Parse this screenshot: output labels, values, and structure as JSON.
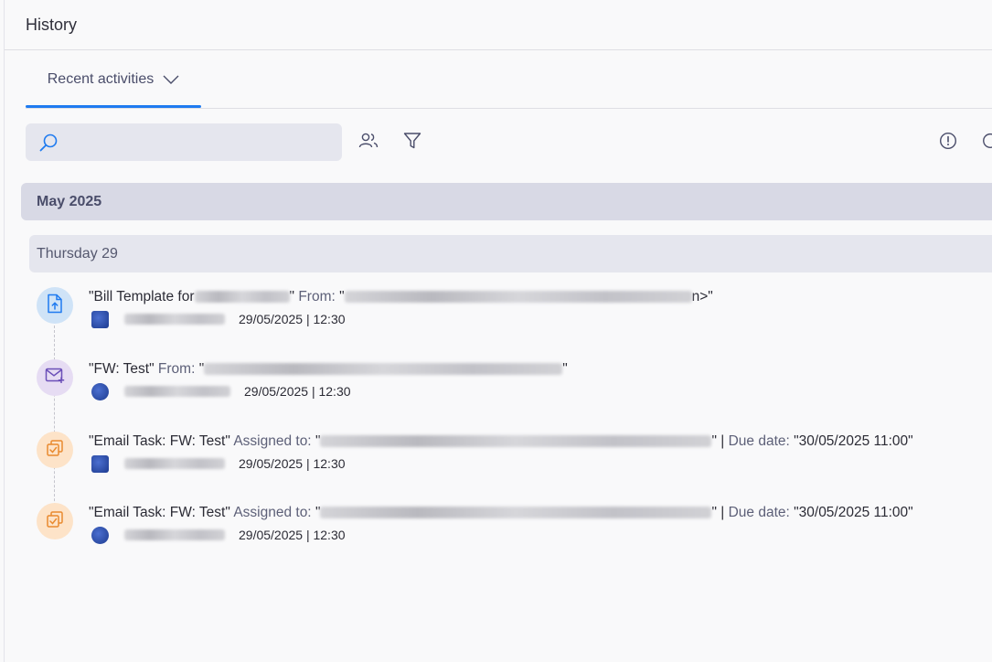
{
  "panel": {
    "title": "History"
  },
  "tabs": {
    "recent_label": "Recent activities"
  },
  "search": {
    "placeholder": ""
  },
  "groups": {
    "month": "May 2025",
    "day": "Thursday 29"
  },
  "icons": {
    "search": "search-icon",
    "users": "users-icon",
    "filter": "filter-icon",
    "info": "info-icon",
    "refresh": "refresh-icon",
    "doc_upload": "document-upload-icon",
    "mail": "mail-icon",
    "task": "task-icon"
  },
  "colors": {
    "accent": "#1f7bf0",
    "doc_bg": "#cfe3f7",
    "mail_bg": "#e6dcf3",
    "task_bg": "#fde3c8",
    "task_fg": "#e98a2f"
  },
  "activities": [
    {
      "title_prefix": "\"Bill Template for",
      "title_suffix": "\"",
      "from_label": "From:",
      "from_open": "\"",
      "from_close": "n>\"",
      "timestamp": "29/05/2025 | 12:30"
    },
    {
      "title": "\"FW: Test\"",
      "from_label": "From:",
      "from_open": "\"",
      "from_close": "\"",
      "timestamp": "29/05/2025 | 12:30"
    },
    {
      "title": "\"Email Task: FW: Test\"",
      "assigned_label": "Assigned to:",
      "assigned_open": "\"",
      "assigned_close": "\" |",
      "due_label": "Due date:",
      "due_value": "\"30/05/2025 11:00\"",
      "timestamp": "29/05/2025 | 12:30"
    },
    {
      "title": "\"Email Task: FW: Test\"",
      "assigned_label": "Assigned to:",
      "assigned_open": "\"",
      "assigned_close": "\" |",
      "due_label": "Due date:",
      "due_value": "\"30/05/2025 11:00\"",
      "timestamp": "29/05/2025 | 12:30"
    }
  ]
}
